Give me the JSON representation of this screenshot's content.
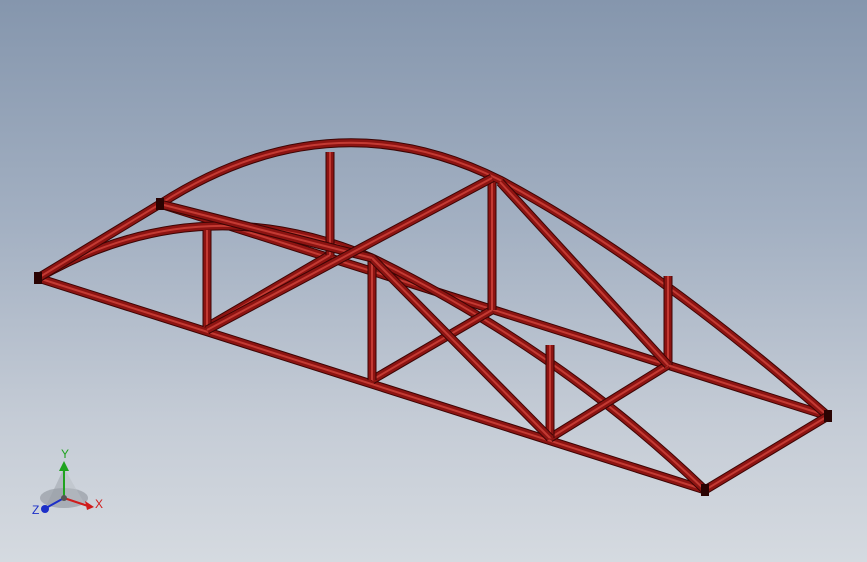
{
  "viewport": {
    "background_top": "#8596ad",
    "background_bottom": "#d5dae0",
    "model": {
      "description_icon": "arch-truss-bridge-model",
      "member_color": "#8d1412",
      "member_shadow": "#3c0504",
      "member_highlight": "#c33a33"
    }
  },
  "triad": {
    "x_label": "X",
    "y_label": "Y",
    "z_label": "Z",
    "x_color": "#d01c1c",
    "y_color": "#1fa31f",
    "z_color": "#1c2fc8"
  }
}
